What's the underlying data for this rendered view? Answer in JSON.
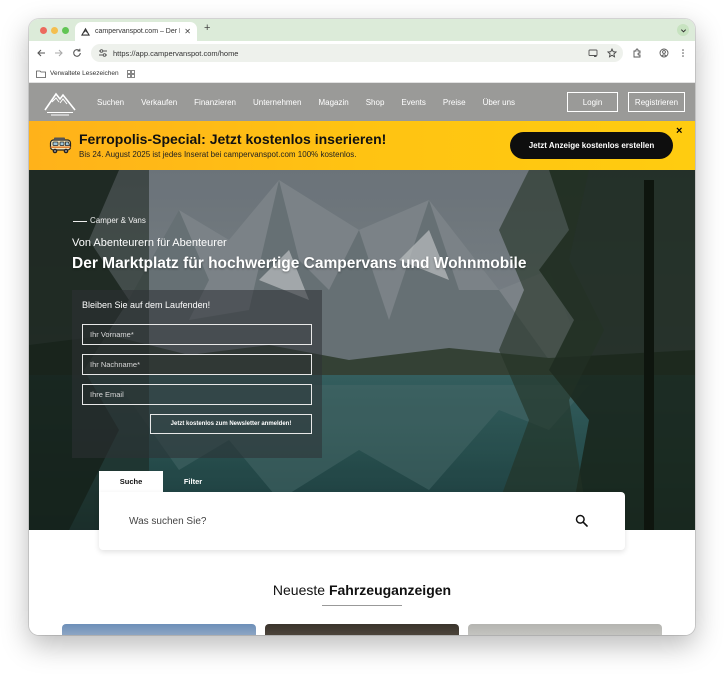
{
  "browser": {
    "tab_title": "campervanspot.com – Der Ma",
    "url": "https://app.campervanspot.com/home",
    "bookmarks_folder": "Verwaltete Lesezeichen"
  },
  "nav": {
    "items": [
      "Suchen",
      "Verkaufen",
      "Finanzieren",
      "Unternehmen",
      "Magazin",
      "Shop",
      "Events",
      "Preise",
      "Über uns"
    ],
    "login": "Login",
    "register": "Registrieren"
  },
  "promo": {
    "title": "Ferropolis-Special: Jetzt kostenlos inserieren!",
    "subtitle": "Bis 24. August 2025 ist jedes Inserat bei campervanspot.com 100% kostenlos.",
    "cta": "Jetzt Anzeige kostenlos erstellen",
    "close": "×",
    "accent_color": "#ffc312"
  },
  "hero": {
    "eyebrow": "Camper & Vans",
    "tagline": "Von Abenteurern für Abenteurer",
    "title": "Der Marktplatz für hochwertige Campervans und Wohnmobile"
  },
  "newsletter": {
    "title": "Bleiben Sie auf dem Laufenden!",
    "firstname_placeholder": "Ihr Vorname*",
    "lastname_placeholder": "Ihr Nachname*",
    "email_placeholder": "Ihre Email",
    "submit": "Jetzt kostenlos zum Newsletter anmelden!"
  },
  "search": {
    "tabs": [
      "Suche",
      "Filter"
    ],
    "active_tab": "Suche",
    "placeholder": "Was suchen Sie?"
  },
  "listings": {
    "heading_plain": "Neueste",
    "heading_bold": "Fahrzeuganzeigen"
  }
}
